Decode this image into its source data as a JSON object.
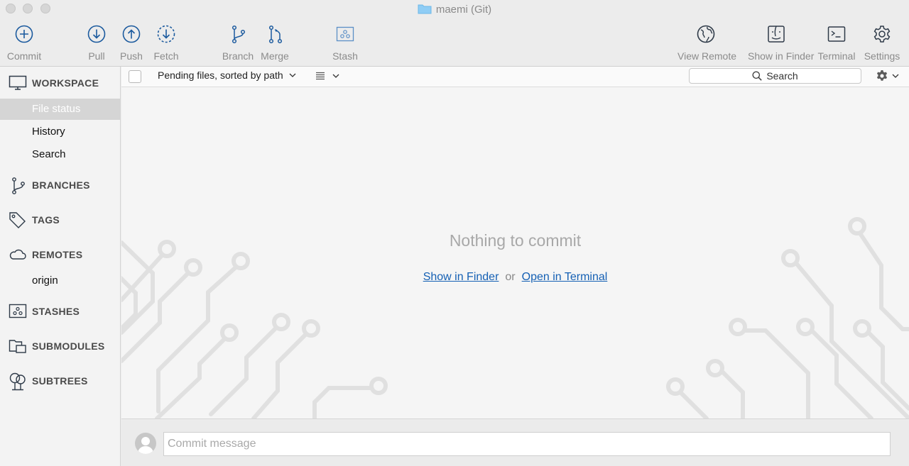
{
  "window": {
    "title": "maemi (Git)"
  },
  "toolbar": {
    "commit": "Commit",
    "pull": "Pull",
    "push": "Push",
    "fetch": "Fetch",
    "branch": "Branch",
    "merge": "Merge",
    "stash": "Stash",
    "view_remote": "View Remote",
    "show_in_finder": "Show in Finder",
    "terminal": "Terminal",
    "settings": "Settings"
  },
  "sidebar": {
    "workspace": {
      "header": "WORKSPACE",
      "items": [
        {
          "label": "File status",
          "selected": true
        },
        {
          "label": "History"
        },
        {
          "label": "Search"
        }
      ]
    },
    "branches": {
      "header": "BRANCHES"
    },
    "tags": {
      "header": "TAGS"
    },
    "remotes": {
      "header": "REMOTES",
      "items": [
        {
          "label": "origin"
        }
      ]
    },
    "stashes": {
      "header": "STASHES"
    },
    "submodules": {
      "header": "SUBMODULES"
    },
    "subtrees": {
      "header": "SUBTREES"
    }
  },
  "file_bar": {
    "sort_label": "Pending files, sorted by path",
    "search_placeholder": "Search"
  },
  "empty_state": {
    "title": "Nothing to commit",
    "show_in_finder": "Show in Finder",
    "or": "or",
    "open_in_terminal": "Open in Terminal"
  },
  "commit": {
    "placeholder": "Commit message"
  },
  "colors": {
    "accent": "#1b5a9e",
    "link": "#1560b4",
    "selection": "#d5d5d5",
    "folder": "#7cc3f2"
  },
  "icons": {
    "commit": "plus-circle-icon",
    "pull": "arrow-down-circle-icon",
    "push": "arrow-up-circle-icon",
    "fetch": "dashed-arrow-down-circle-icon",
    "branch": "branch-icon",
    "merge": "merge-icon",
    "stash": "stash-icon",
    "view_remote": "globe-icon",
    "show_in_finder": "finder-icon",
    "terminal": "terminal-icon",
    "settings": "gear-icon"
  }
}
